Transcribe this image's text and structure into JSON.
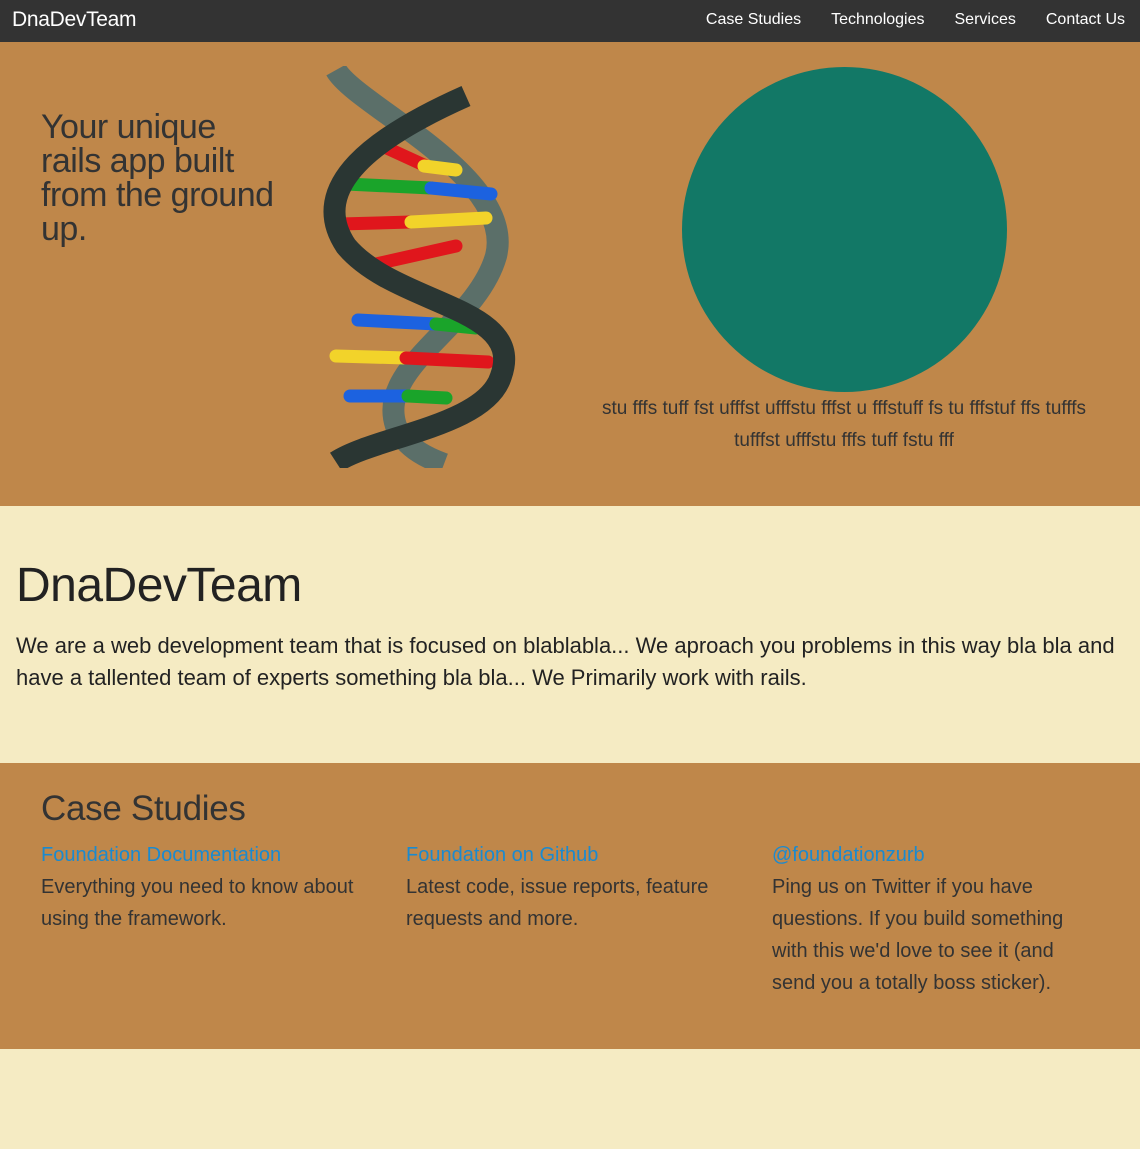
{
  "colors": {
    "topbar": "#333333",
    "hero_bg": "#bf874a",
    "page_bg": "#f5ebc3",
    "circle": "#127866",
    "link": "#1a8ad0"
  },
  "topbar": {
    "brand": "DnaDevTeam",
    "nav": [
      "Case Studies",
      "Technologies",
      "Services",
      "Contact Us"
    ]
  },
  "hero": {
    "tagline": "Your unique rails app built from the ground up.",
    "image_icon": "dna-helix-icon",
    "text": "stu fffs tuff fst ufffst ufffstu fffst u fffstuff fs tu fffstuf ffs tufffs tufffst ufffstu fffs tuff fstu fff"
  },
  "about": {
    "title": "DnaDevTeam",
    "body": "We are a web development team that is focused on blablabla... We aproach you problems in this way bla bla and have a tallented team of experts something bla bla... We Primarily work with rails."
  },
  "cases": {
    "title": "Case Studies",
    "items": [
      {
        "link": "Foundation Documentation",
        "text": "Everything you need to know about using the framework."
      },
      {
        "link": "Foundation on Github",
        "text": "Latest code, issue reports, feature requests and more."
      },
      {
        "link": "@foundationzurb",
        "text": "Ping us on Twitter if you have questions. If you build something with this we'd love to see it (and send you a totally boss sticker)."
      }
    ]
  }
}
